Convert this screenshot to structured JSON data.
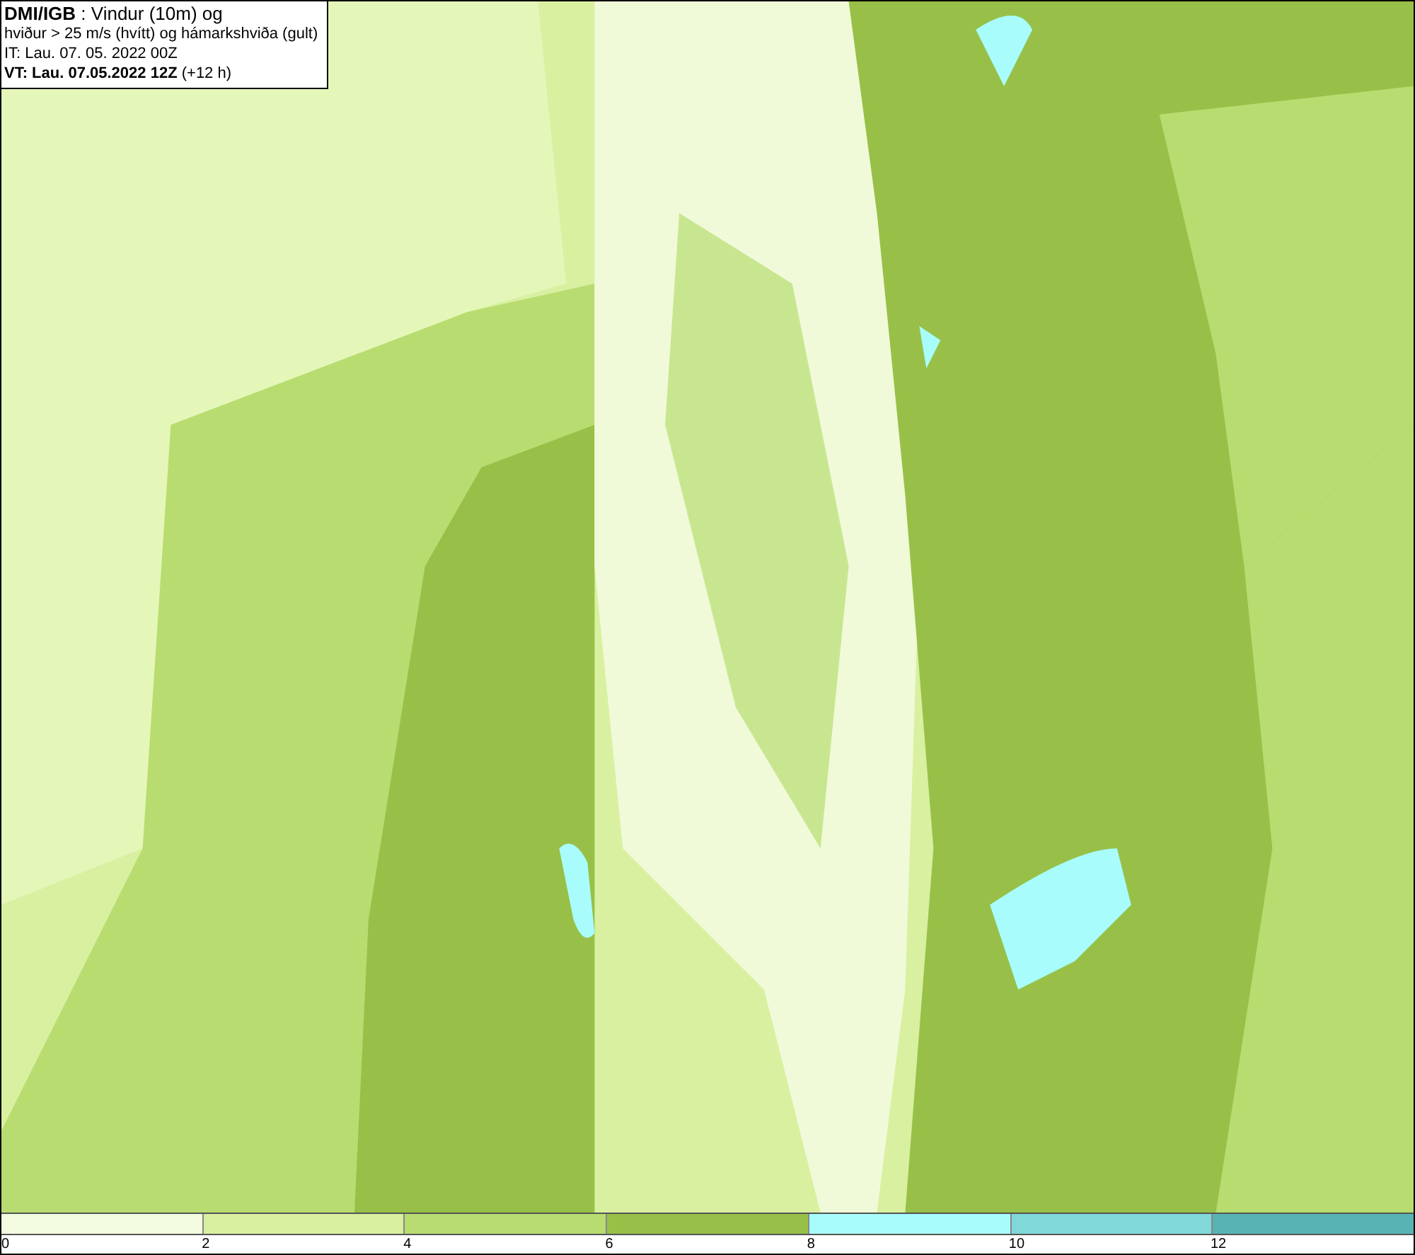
{
  "header": {
    "lines": [
      "**DMI/IGB** : Vindur (10m) og",
      "hviður > 25 m/s (hvítt) og hámarkshviða (gult)",
      "IT: Lau. 07. 05. 2022 00Z",
      "**VT: Lau. 07.05.2022 12Z** (+12 h)"
    ]
  },
  "legend": {
    "bins": [
      {
        "color": "#f4fce0",
        "label": "0"
      },
      {
        "color": "#d8f0a0",
        "label": "2"
      },
      {
        "color": "#b8dc70",
        "label": "4"
      },
      {
        "color": "#98c048",
        "label": "6"
      },
      {
        "color": "#a8fcfc",
        "label": "8"
      },
      {
        "color": "#80d8d8",
        "label": "10"
      },
      {
        "color": "#58b4b4",
        "label": "12"
      }
    ]
  }
}
